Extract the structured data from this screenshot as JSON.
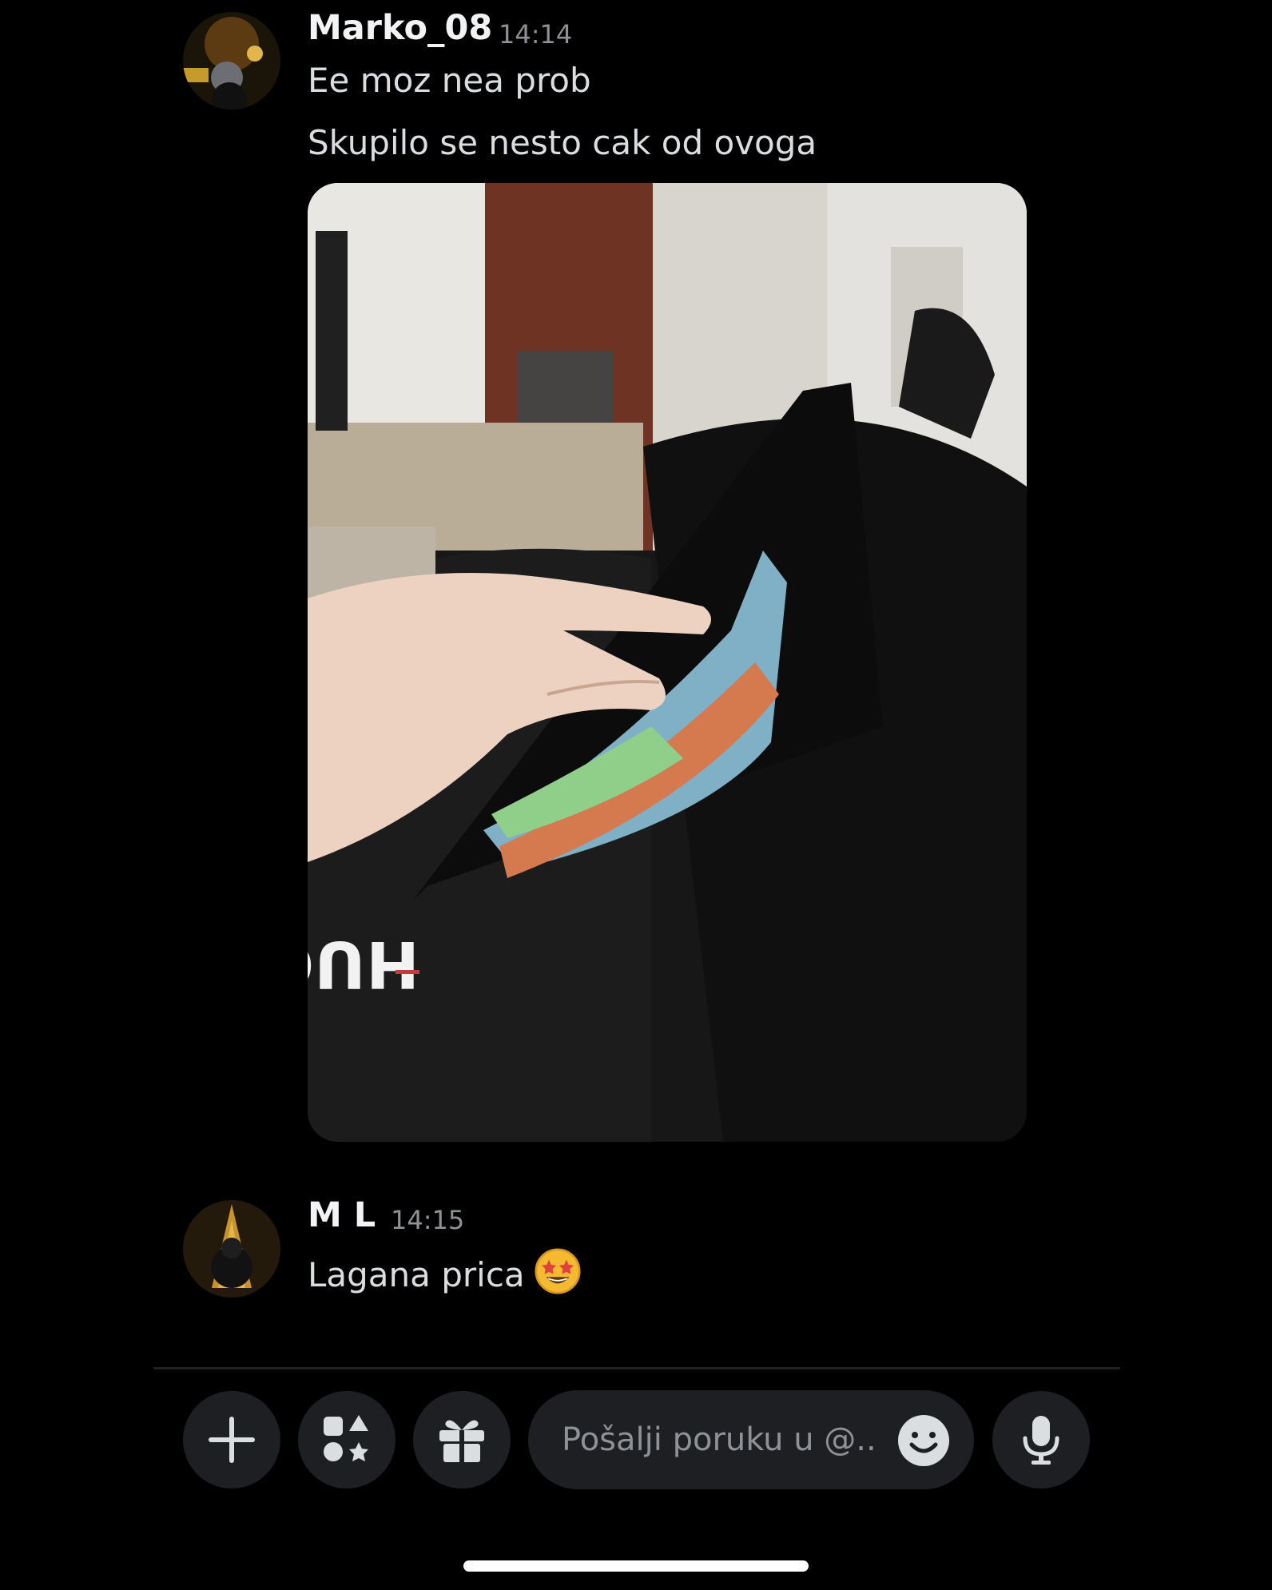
{
  "messages": [
    {
      "username": "Marko_08",
      "time": "14:14",
      "lines": [
        "Ee moz nea prob",
        "Skupilo se nesto cak od ovoga"
      ]
    },
    {
      "username": "M L",
      "time": "14:15",
      "text": "Lagana prica"
    }
  ],
  "composer": {
    "placeholder": "Pošalji poruku u @.."
  },
  "icons": {
    "add": "plus-icon",
    "apps": "apps-icon",
    "gift": "gift-icon",
    "emoji": "smiley-icon",
    "mic": "microphone-icon",
    "reaction": "star-struck-emoji"
  },
  "colors": {
    "background": "#000000",
    "surface": "#1e1f22",
    "text": "#dbdee1",
    "muted": "#8e9297"
  }
}
